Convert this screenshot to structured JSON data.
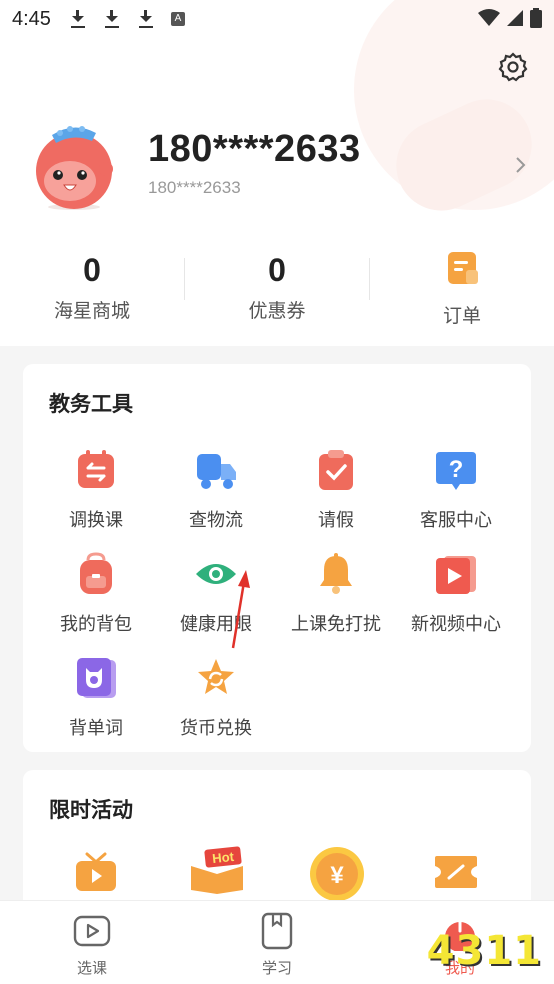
{
  "status_bar": {
    "time": "4:45",
    "a_badge": "A"
  },
  "profile": {
    "phone_main": "180****2633",
    "phone_sub": "180****2633"
  },
  "stats": [
    {
      "value": "0",
      "label": "海星商城"
    },
    {
      "value": "0",
      "label": "优惠券"
    },
    {
      "label": "订单"
    }
  ],
  "tools": {
    "title": "教务工具",
    "items": [
      {
        "label": "调换课",
        "icon": "swap-class-icon"
      },
      {
        "label": "查物流",
        "icon": "truck-icon"
      },
      {
        "label": "请假",
        "icon": "leave-request-icon"
      },
      {
        "label": "客服中心",
        "icon": "help-center-icon"
      },
      {
        "label": "我的背包",
        "icon": "backpack-icon"
      },
      {
        "label": "健康用眼",
        "icon": "eye-icon"
      },
      {
        "label": "上课免打扰",
        "icon": "bell-icon"
      },
      {
        "label": "新视频中心",
        "icon": "video-icon"
      },
      {
        "label": "背单词",
        "icon": "vocabulary-icon"
      },
      {
        "label": "货币兑换",
        "icon": "currency-star-icon"
      }
    ]
  },
  "activities": {
    "title": "限时活动",
    "hot_badge": "Hot",
    "coin_symbol": "¥"
  },
  "bottom_nav": [
    {
      "label": "选课"
    },
    {
      "label": "学习"
    },
    {
      "label": "我的"
    }
  ],
  "watermark": "4311",
  "colors": {
    "accent_orange": "#f7a33a",
    "accent_red": "#ef5a4f",
    "accent_blue": "#4b8ff0",
    "accent_green": "#2fb07c",
    "accent_purple": "#8b67e6"
  }
}
